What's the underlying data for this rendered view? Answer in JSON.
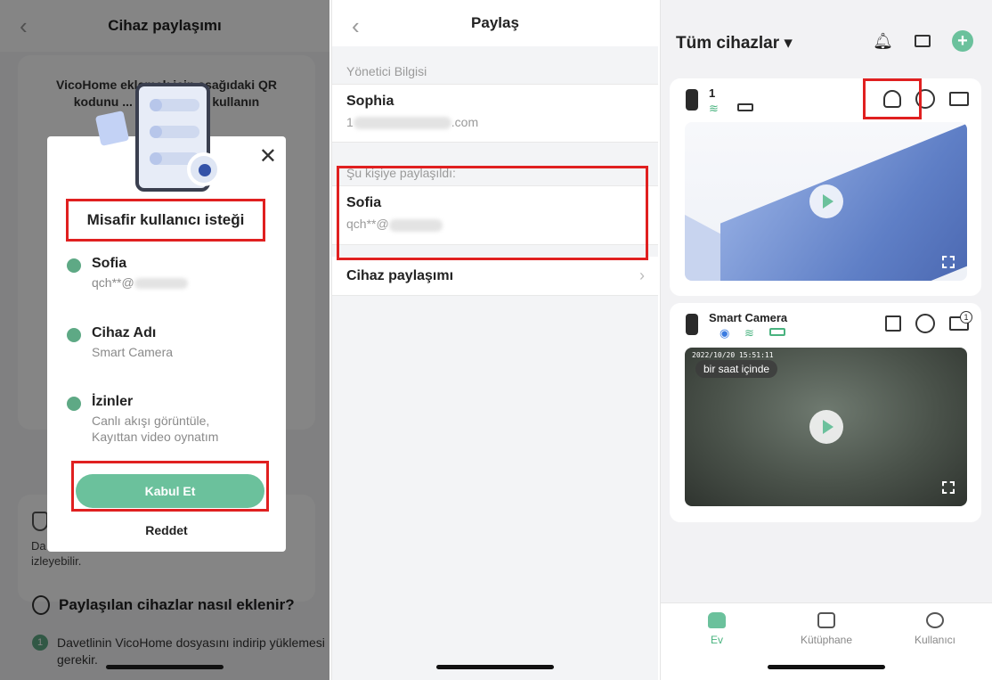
{
  "screen1": {
    "header_title": "Cihaz paylaşımı",
    "intro_text": "VicoHome eklemek için aşağıdaki QR kodunu ... lütfen kam... kullanın",
    "bottom_text_prefix": "Da",
    "bottom_text_line": "izleyebilir.",
    "howto_title": "Paylaşılan cihazlar nasıl eklenir?",
    "step_num": "1",
    "step_text": "Davetlinin VicoHome dosyasını indirip yüklemesi gerekir.",
    "modal": {
      "title": "Misafir kullanıcı isteği",
      "user_name": "Sofia",
      "user_email": "qch**@",
      "device_label": "Cihaz Adı",
      "device_value": "Smart Camera",
      "perm_label": "İzinler",
      "perm_value": "Canlı akışı görüntüle, Kayıttan video oynatım",
      "accept": "Kabul Et",
      "reject": "Reddet"
    }
  },
  "screen2": {
    "header_title": "Paylaş",
    "admin_section": "Yönetici Bilgisi",
    "admin_name": "Sophia",
    "admin_email_prefix": "1",
    "admin_email_suffix": ".com",
    "shared_section": "Şu kişiye paylaşıldı:",
    "shared_name": "Sofia",
    "shared_email": "qch**@",
    "device_share_row": "Cihaz paylaşımı"
  },
  "screen3": {
    "title": "Tüm cihazlar ▾",
    "card1_name": "1",
    "card2_name": "Smart Camera",
    "timestamp": "2022/10/20 15:51:11",
    "chip": "bir saat içinde",
    "badge": "1",
    "tabs": [
      "Ev",
      "Kütüphane",
      "Kullanıcı"
    ]
  },
  "colors": {
    "accent": "#6bc19c",
    "highlight": "#e02020"
  }
}
